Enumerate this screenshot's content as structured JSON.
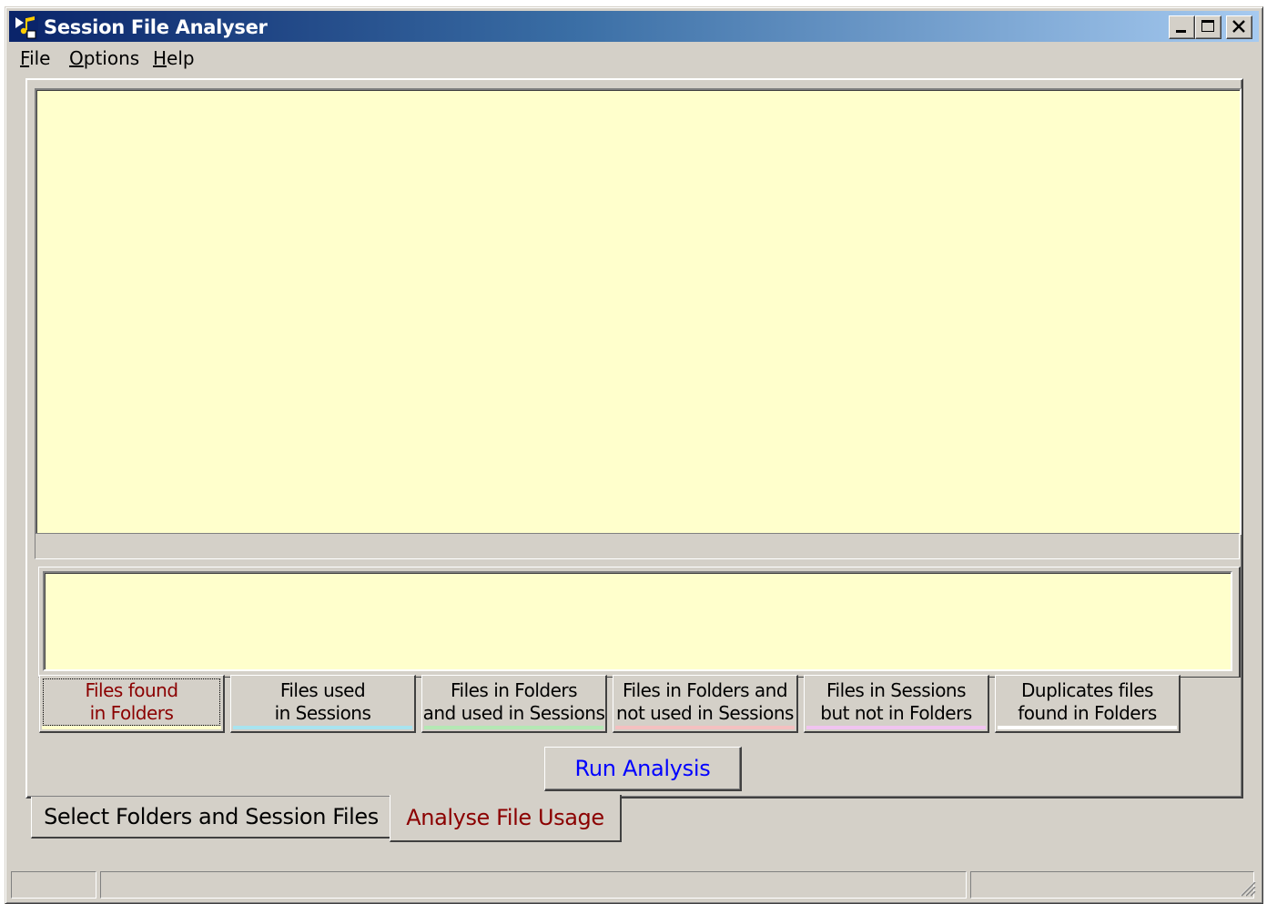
{
  "window": {
    "title": "Session File Analyser"
  },
  "titlebar_buttons": {
    "minimize_icon": "minimize-icon",
    "maximize_icon": "maximize-icon",
    "close_icon": "close-icon"
  },
  "menu": [
    {
      "accel": "F",
      "rest": "ile"
    },
    {
      "accel": "O",
      "rest": "ptions"
    },
    {
      "accel": "H",
      "rest": "elp"
    }
  ],
  "result_tabs": [
    {
      "line1": "Files found",
      "line2": "in Folders",
      "color": "#ffffcc",
      "active": true
    },
    {
      "line1": "Files used",
      "line2": "in Sessions",
      "color": "#a8e4f0",
      "active": false
    },
    {
      "line1": "Files in Folders",
      "line2": "and used in Sessions",
      "color": "#b4e8b4",
      "active": false
    },
    {
      "line1": "Files in Folders and",
      "line2": "not used in Sessions",
      "color": "#f4c0c0",
      "active": false
    },
    {
      "line1": "Files in Sessions",
      "line2": "but not in Folders",
      "color": "#f0c4f0",
      "active": false
    },
    {
      "line1": "Duplicates files",
      "line2": "found in Folders",
      "color": "#ffffff",
      "active": false
    }
  ],
  "run_button": {
    "label": "Run Analysis",
    "color": "#0000ff"
  },
  "page_tabs": [
    {
      "label": "Select Folders and Session Files",
      "active": false
    },
    {
      "label": "Analyse File Usage",
      "active": true
    }
  ],
  "colors": {
    "panel_bg": "#ffffcc",
    "active_tab_text": "#8b0000",
    "window_bg": "#d4d0c8"
  }
}
